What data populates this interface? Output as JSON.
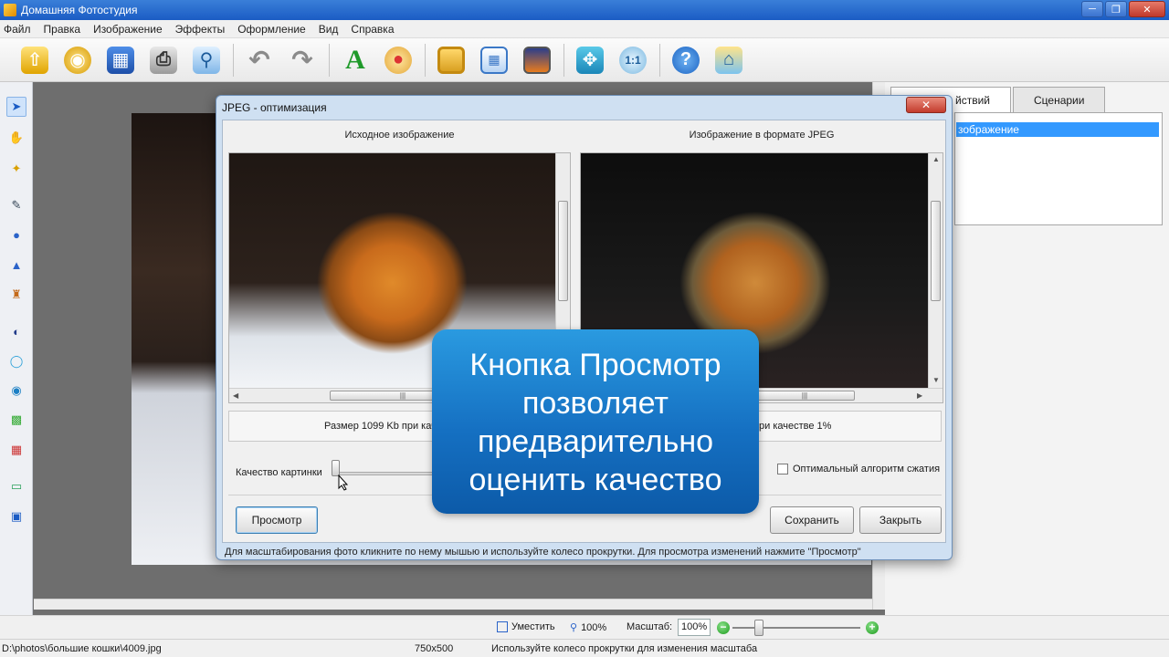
{
  "window": {
    "title": "Домашняя Фотостудия"
  },
  "menu": [
    "Файл",
    "Правка",
    "Изображение",
    "Эффекты",
    "Оформление",
    "Вид",
    "Справка"
  ],
  "right_panel": {
    "tabs": [
      "йствий",
      "Сценарии"
    ],
    "selected_item": "зображение"
  },
  "dialog": {
    "title": "JPEG - оптимизация",
    "left_label": "Исходное изображение",
    "right_label": "Изображение в формате JPEG",
    "size_text_left": "Размер 1099 Kb при каче",
    "size_text_right": "ри качестве 1%",
    "quality_label": "Качество картинки",
    "optimal_label": "Оптимальный алгоритм сжатия",
    "preview_btn": "Просмотр",
    "save_btn": "Сохранить",
    "close_btn": "Закрыть",
    "status": "Для масштабирования фото кликните по нему мышью и используйте колесо прокрутки. Для просмотра изменений нажмите \"Просмотр\""
  },
  "callout": {
    "lines": [
      "Кнопка Просмотр",
      "позволяет",
      "предварительно",
      "оценить качество"
    ]
  },
  "zoombar": {
    "fit": "Уместить",
    "hundred": "100%",
    "scale_label": "Масштаб:",
    "scale_value": "100%"
  },
  "status": {
    "path": "D:\\photos\\большие кошки\\4009.jpg",
    "dimensions": "750x500",
    "hint": "Используйте колесо прокрутки для изменения масштаба"
  }
}
